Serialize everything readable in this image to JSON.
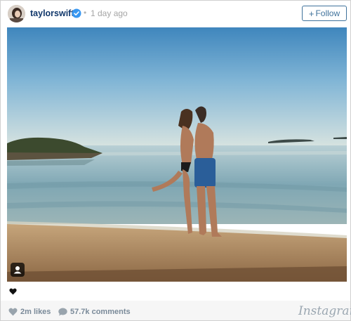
{
  "post": {
    "username": "taylorswift",
    "verified_icon": "verified-badge-icon",
    "separator": "•",
    "time": "1 day ago",
    "follow_label": "Follow",
    "follow_plus": "+",
    "likes": "2m likes",
    "comments": "57.7k comments",
    "brand": "Instagram"
  },
  "colors": {
    "link_blue": "#3f729b",
    "verified_blue": "#3897f0",
    "username": "#12386b",
    "muted": "#a5a5a5"
  },
  "icons": {
    "user_tag": "person-tag-icon",
    "like": "heart-icon",
    "comment": "speech-bubble-icon"
  }
}
